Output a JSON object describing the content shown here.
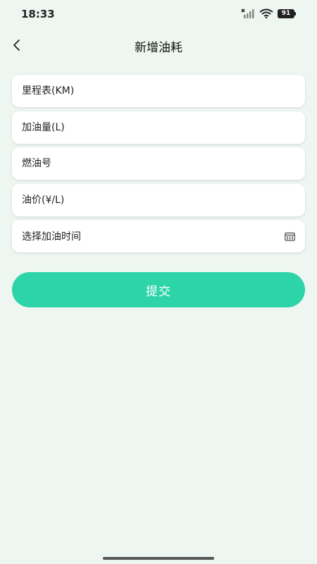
{
  "status_bar": {
    "time": "18:33",
    "battery": "91",
    "icons": [
      "signal-icon",
      "wifi-icon",
      "battery-icon"
    ]
  },
  "header": {
    "title": "新增油耗",
    "back_icon": "chevron-left-icon"
  },
  "form": {
    "mileage_placeholder": "里程表(KM)",
    "fuel_amount_placeholder": "加油量(L)",
    "fuel_grade_placeholder": "燃油号",
    "fuel_price_placeholder": "油价(¥/L)",
    "refuel_time_label": "选择加油时间",
    "refuel_time_icon": "calendar-icon"
  },
  "actions": {
    "submit_label": "提交"
  },
  "colors": {
    "background": "#eef6f1",
    "accent": "#2dd4a7",
    "card": "#ffffff"
  }
}
